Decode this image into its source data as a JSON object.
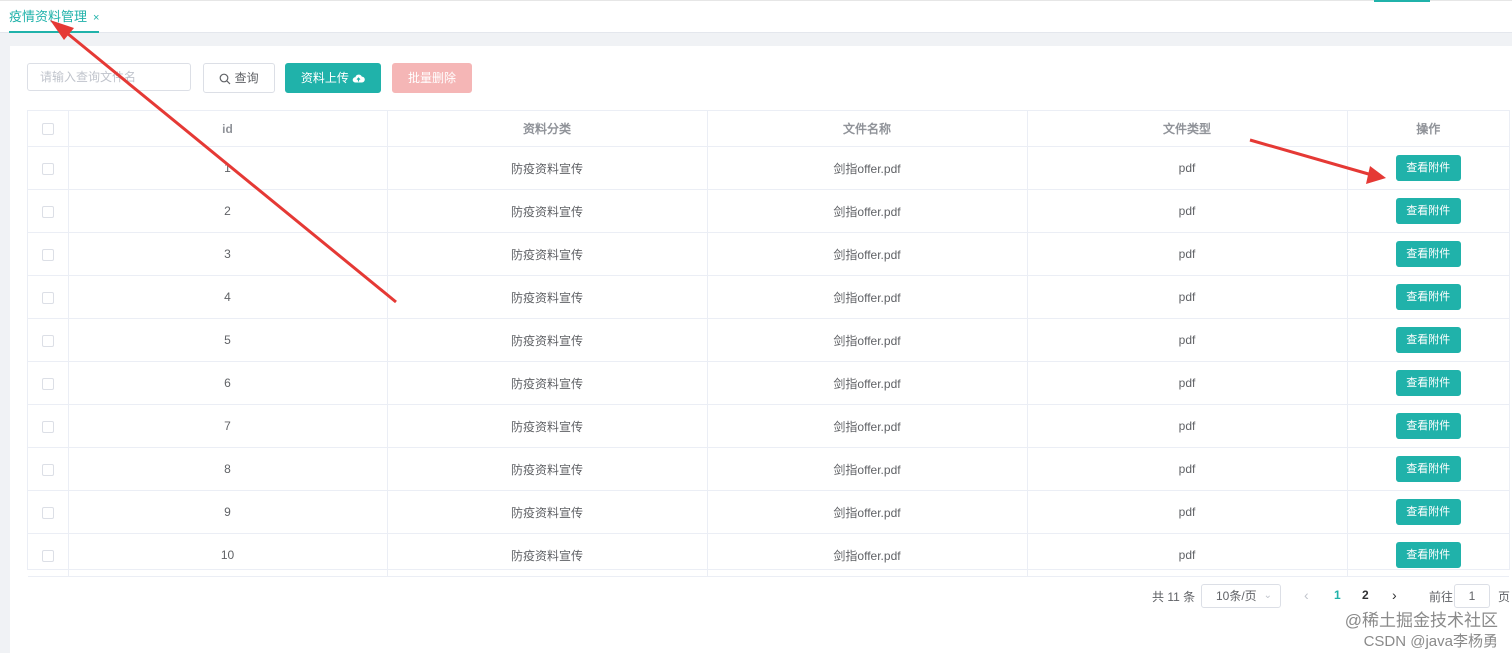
{
  "tabs": [
    {
      "label": "疫情资料管理",
      "close": "×"
    }
  ],
  "toolbar": {
    "search_placeholder": "请输入查询文件名",
    "query_label": "查询",
    "upload_label": "资料上传",
    "delete_label": "批量删除"
  },
  "table": {
    "headers": [
      "id",
      "资料分类",
      "文件名称",
      "文件类型",
      "操作"
    ],
    "rows": [
      {
        "id": "1",
        "category": "防疫资料宣传",
        "name": "剑指offer.pdf",
        "type": "pdf",
        "action": "查看附件"
      },
      {
        "id": "2",
        "category": "防疫资料宣传",
        "name": "剑指offer.pdf",
        "type": "pdf",
        "action": "查看附件"
      },
      {
        "id": "3",
        "category": "防疫资料宣传",
        "name": "剑指offer.pdf",
        "type": "pdf",
        "action": "查看附件"
      },
      {
        "id": "4",
        "category": "防疫资料宣传",
        "name": "剑指offer.pdf",
        "type": "pdf",
        "action": "查看附件"
      },
      {
        "id": "5",
        "category": "防疫资料宣传",
        "name": "剑指offer.pdf",
        "type": "pdf",
        "action": "查看附件"
      },
      {
        "id": "6",
        "category": "防疫资料宣传",
        "name": "剑指offer.pdf",
        "type": "pdf",
        "action": "查看附件"
      },
      {
        "id": "7",
        "category": "防疫资料宣传",
        "name": "剑指offer.pdf",
        "type": "pdf",
        "action": "查看附件"
      },
      {
        "id": "8",
        "category": "防疫资料宣传",
        "name": "剑指offer.pdf",
        "type": "pdf",
        "action": "查看附件"
      },
      {
        "id": "9",
        "category": "防疫资料宣传",
        "name": "剑指offer.pdf",
        "type": "pdf",
        "action": "查看附件"
      },
      {
        "id": "10",
        "category": "防疫资料宣传",
        "name": "剑指offer.pdf",
        "type": "pdf",
        "action": "查看附件"
      }
    ]
  },
  "pagination": {
    "total_text": "共 11 条",
    "page_size": "10条/页",
    "pages": [
      "1",
      "2"
    ],
    "current_page": "1",
    "goto_label": "前往",
    "goto_value": "1",
    "page_suffix": "页"
  },
  "watermark": {
    "line1": "@稀土掘金技术社区",
    "line2": "CSDN @java李杨勇"
  },
  "colors": {
    "accent": "#20b2aa",
    "danger_disabled": "#f5b6b6",
    "annotation_arrow": "#e53935"
  },
  "icons": [
    "search-icon",
    "cloud-upload-icon",
    "chevron-down-icon",
    "chevron-left-icon",
    "chevron-right-icon"
  ]
}
